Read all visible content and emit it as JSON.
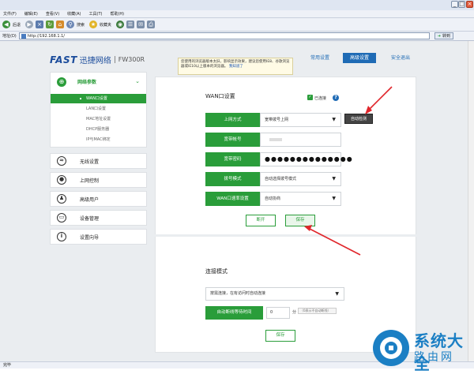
{
  "browser": {
    "menu": [
      "文件(F)",
      "编辑(E)",
      "查看(V)",
      "收藏(A)",
      "工具(T)",
      "帮助(H)"
    ],
    "toolbar": {
      "back": "后退",
      "search": "搜索",
      "favorites": "收藏夹"
    },
    "address_label": "地址(D)",
    "address": "http://192.168.1.1/",
    "go": "转到",
    "status": "完毕"
  },
  "header": {
    "logo_brand": "FAST",
    "logo_cn": "迅捷网络",
    "logo_model": "FW300R",
    "notice_text": "您使用的浏览器版本太旧，影响显示效果，建议您使用IE8、谷歌浏览器或IE10以上版本的浏览器。",
    "notice_link": "我知道了",
    "nav": {
      "common": "常用设置",
      "advanced": "高级设置",
      "logout": "安全退出"
    }
  },
  "sidebar": {
    "group_title": "网络参数",
    "sub_items": [
      "WAN口设置",
      "LAN口设置",
      "MAC地址设置",
      "DHCP服务器",
      "IP与MAC绑定"
    ],
    "items": [
      "无线设置",
      "上网控制",
      "高级用户",
      "设备管理",
      "设置向导"
    ]
  },
  "wan": {
    "title": "WAN口设置",
    "enabled_label": "已连接",
    "detect_button": "自动检测",
    "rows": [
      {
        "label": "上网方式",
        "value": "宽带拨号上网",
        "dropdown": true
      },
      {
        "label": "宽带帐号",
        "value": "",
        "dropdown": false
      },
      {
        "label": "宽带密码",
        "value": "●●●●●●●●●●●●●●",
        "dropdown": false
      },
      {
        "label": "拨号模式",
        "value": "自动选择拨号模式",
        "dropdown": true
      },
      {
        "label": "WAN口速率设置",
        "value": "自动协商",
        "dropdown": true
      }
    ],
    "connect_button": "断开",
    "save_button": "保存"
  },
  "connection": {
    "title": "连接模式",
    "mode_value": "按需连接，在有访问时自动连接",
    "idle_label": "自动断线等待时间",
    "idle_value": "0",
    "idle_unit": "分",
    "idle_hint": "（0表示不自动断线）",
    "save_button": "保存"
  },
  "watermark": {
    "text": "系统大全",
    "sub": "路由网"
  },
  "colors": {
    "accent_green": "#2a9d3a",
    "nav_blue": "#1f6bb5",
    "annotation_red": "#e0262b"
  }
}
